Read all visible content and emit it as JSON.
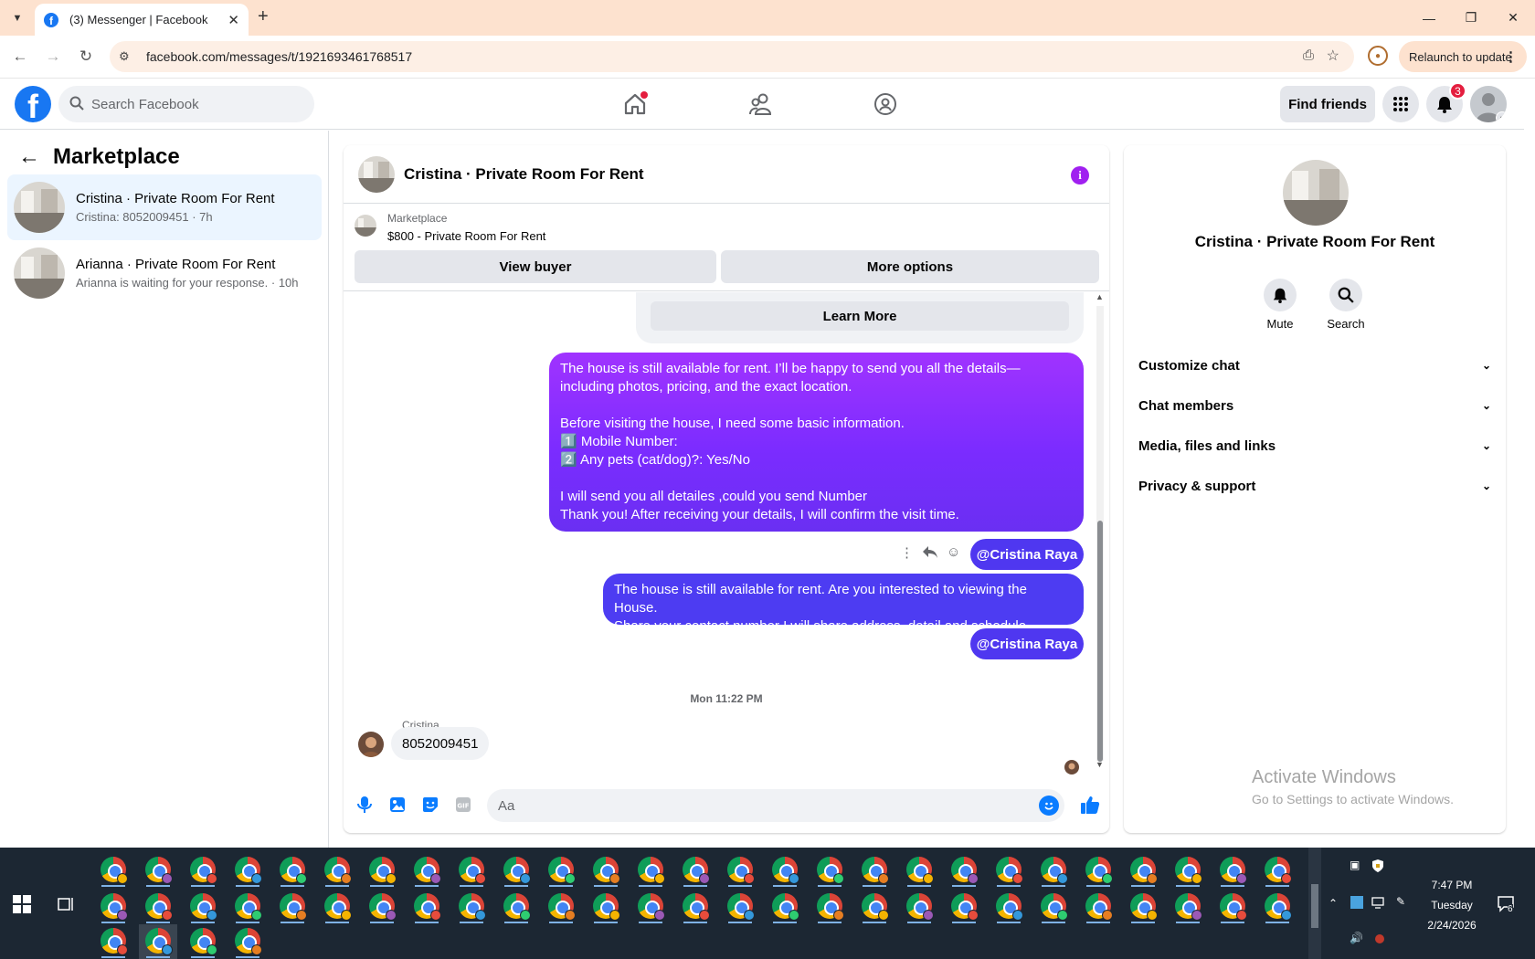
{
  "browser": {
    "tab_title": "(3) Messenger | Facebook",
    "url": "facebook.com/messages/t/1921693461768517",
    "relaunch_label": "Relaunch to update"
  },
  "fb": {
    "search_placeholder": "Search Facebook",
    "find_friends": "Find friends",
    "notif_count": "3"
  },
  "left": {
    "title": "Marketplace",
    "conversations": [
      {
        "name": "Cristina · Private Room For Rent",
        "snippet": "Cristina: 8052009451 · 7h"
      },
      {
        "name": "Arianna · Private Room For Rent",
        "snippet": "Arianna is waiting for your response. · 10h"
      }
    ]
  },
  "chat": {
    "title": "Cristina · Private Room For Rent",
    "listing_label": "Marketplace",
    "listing_price": "$800 - Private Room For Rent",
    "view_buyer": "View buyer",
    "more_options": "More options",
    "learn_more": "Learn More",
    "msg1": "The house is still available for rent. I’ll be happy to send you all the details—including photos, pricing, and the exact location.\n\nBefore visiting the house, I need some basic information.\n1️⃣  Mobile Number:\n2️⃣ Any pets (cat/dog)?: Yes/No\n\nI will send you all detailes ,could you send Number\nThank you! After receiving your details, I will confirm the visit time.",
    "mention1": "@Cristina Raya",
    "msg2": "The house is still available for rent. Are you interested to viewing  the House.\nShare your contact number I will share address ,detail and schedule",
    "mention2": "@Cristina Raya",
    "timestamp": "Mon 11:22 PM",
    "sender": "Cristina",
    "incoming": "8052009451",
    "composer_placeholder": "Aa"
  },
  "right": {
    "name": "Cristina · Private Room For Rent",
    "mute": "Mute",
    "search": "Search",
    "sections": [
      "Customize chat",
      "Chat members",
      "Media, files and links",
      "Privacy & support"
    ]
  },
  "watermark": {
    "line1": "Activate Windows",
    "line2": "Go to Settings to activate Windows."
  },
  "taskbar": {
    "time": "7:47 PM",
    "day": "Tuesday",
    "date": "2/24/2026",
    "notif_count": "6"
  },
  "colors": {
    "fb_blue": "#1877f2",
    "bubble_purple": "#7b2cff",
    "bubble_blue": "#4d3cf2",
    "badge_red": "#e41e3f"
  }
}
